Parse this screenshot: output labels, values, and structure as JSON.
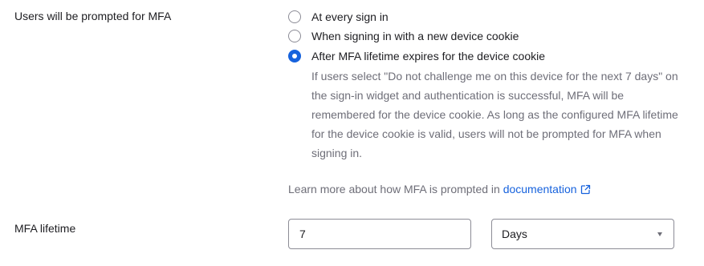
{
  "prompt_setting": {
    "label": "Users will be prompted for MFA",
    "options": [
      {
        "label": "At every sign in",
        "selected": false
      },
      {
        "label": "When signing in with a new device cookie",
        "selected": false
      },
      {
        "label": "After MFA lifetime expires for the device cookie",
        "selected": true
      }
    ],
    "description": "If users select \"Do not challenge me on this device for the next 7 days\" on the sign-in widget and authentication is successful, MFA will be remembered for the device cookie. As long as the configured MFA lifetime for the device cookie is valid, users will not be prompted for MFA when signing in.",
    "learn_more_text": "Learn more about how MFA is prompted in",
    "learn_more_link": "documentation",
    "learn_more_icon": "external-link-icon"
  },
  "lifetime": {
    "label": "MFA lifetime",
    "value": "7",
    "unit": "Days",
    "unit_icon": "chevron-down-icon"
  },
  "colors": {
    "accent": "#1662dd",
    "muted_text": "#6e6e78",
    "border": "#8c8c96"
  }
}
